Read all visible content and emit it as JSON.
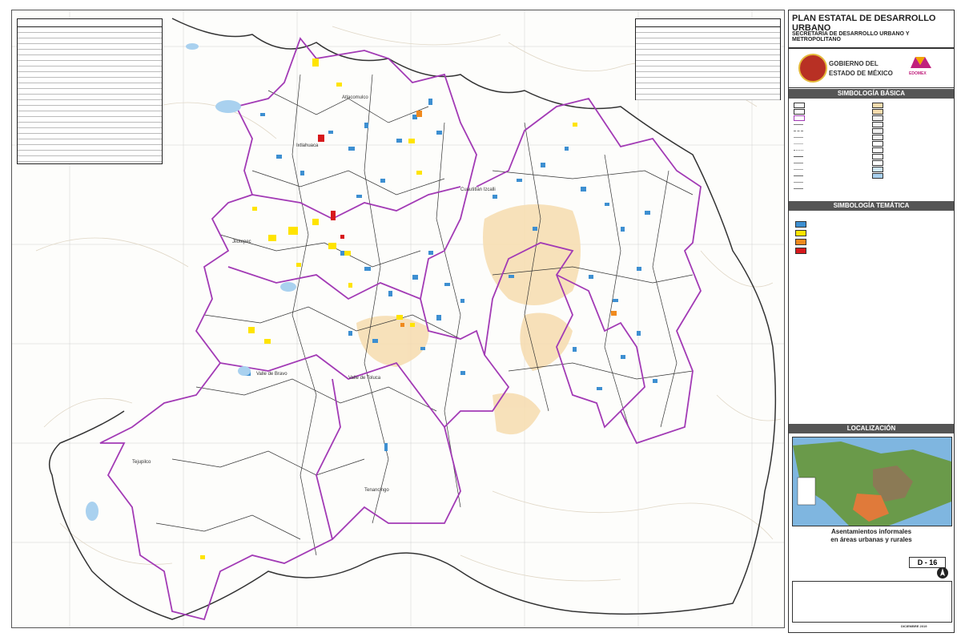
{
  "panel": {
    "title": "PLAN ESTATAL DE DESARROLLO URBANO",
    "subtitle": "SECRETARÍA DE DESARROLLO URBANO Y METROPOLITANO",
    "gov_line1": "GOBIERNO DEL",
    "gov_line2": "ESTADO DE MÉXICO",
    "brand": "EDOMEX"
  },
  "sections": {
    "basic": "SIMBOLOGÍA BÁSICA",
    "thematic": "SIMBOLOGÍA TEMÁTICA",
    "location": "LOCALIZACIÓN"
  },
  "map_title": {
    "line1": "Asentamientos informales",
    "line2": "en áreas urbanas y rurales"
  },
  "sheet_code": "D - 16",
  "date": "DICIEMBRE 2019",
  "region_labels": {
    "r1": "Atlacomulco",
    "r2": "Ixtlahuaca",
    "r3": "Jilotepec",
    "r4": "Valle de Toluca",
    "r5": "Tejupilco",
    "r6": "Cuautitlán Izcalli",
    "r7": "Valle de Bravo",
    "r8": "Tenancingo"
  },
  "colors": {
    "blue": "#3d8fd1",
    "yellow": "#ffe400",
    "orange": "#f08a1e",
    "red": "#d7191c",
    "purple": "#a23ab5",
    "urban": "#f6dcae"
  }
}
